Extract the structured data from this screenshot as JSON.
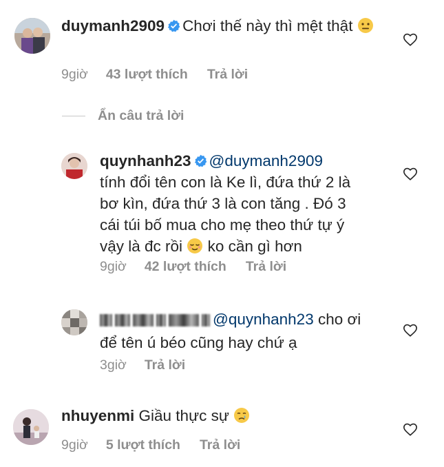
{
  "comments": [
    {
      "username": "duymanh2909",
      "text": "Chơi thế này thì mệt thật",
      "emoji": "neutral-face",
      "time": "9giờ",
      "likes": "43 lượt thích",
      "reply": "Trả lời"
    },
    {
      "username": "quynhanh23",
      "mention": "@duymanh2909",
      "text_line1": "tính đổi tên con là Ke lì, đứa thứ 2 là",
      "text_line2": "bơ kìn, đứa thứ 3 là con tăng . Đó 3",
      "text_line3": "cái túi bố mua cho mẹ theo thứ tự ý",
      "text_line4a": "vậy là đc rồi",
      "emoji": "relieved-face",
      "text_line4b": "ko cần gì hơn",
      "time": "9giờ",
      "likes": "42 lượt thích",
      "reply": "Trả lời"
    },
    {
      "mention": "@quynhanh23",
      "text_line1": "cho ơi",
      "text_line2": "để tên ú béo cũng hay chứ ạ",
      "time": "3giờ",
      "reply": "Trả lời"
    },
    {
      "username": "nhuyenmi",
      "text": "Giầu thực sự",
      "emoji": "crying-face",
      "time": "9giờ",
      "likes": "5 lượt thích",
      "reply": "Trả lời"
    }
  ],
  "hide_replies_label": "Ẩn câu trả lời",
  "colors": {
    "text": "#262626",
    "meta": "#8e8e8e",
    "mention": "#00376b",
    "verified": "#3897f0"
  },
  "icons": {
    "verified": "verified-badge-icon",
    "like": "heart-outline-icon"
  }
}
